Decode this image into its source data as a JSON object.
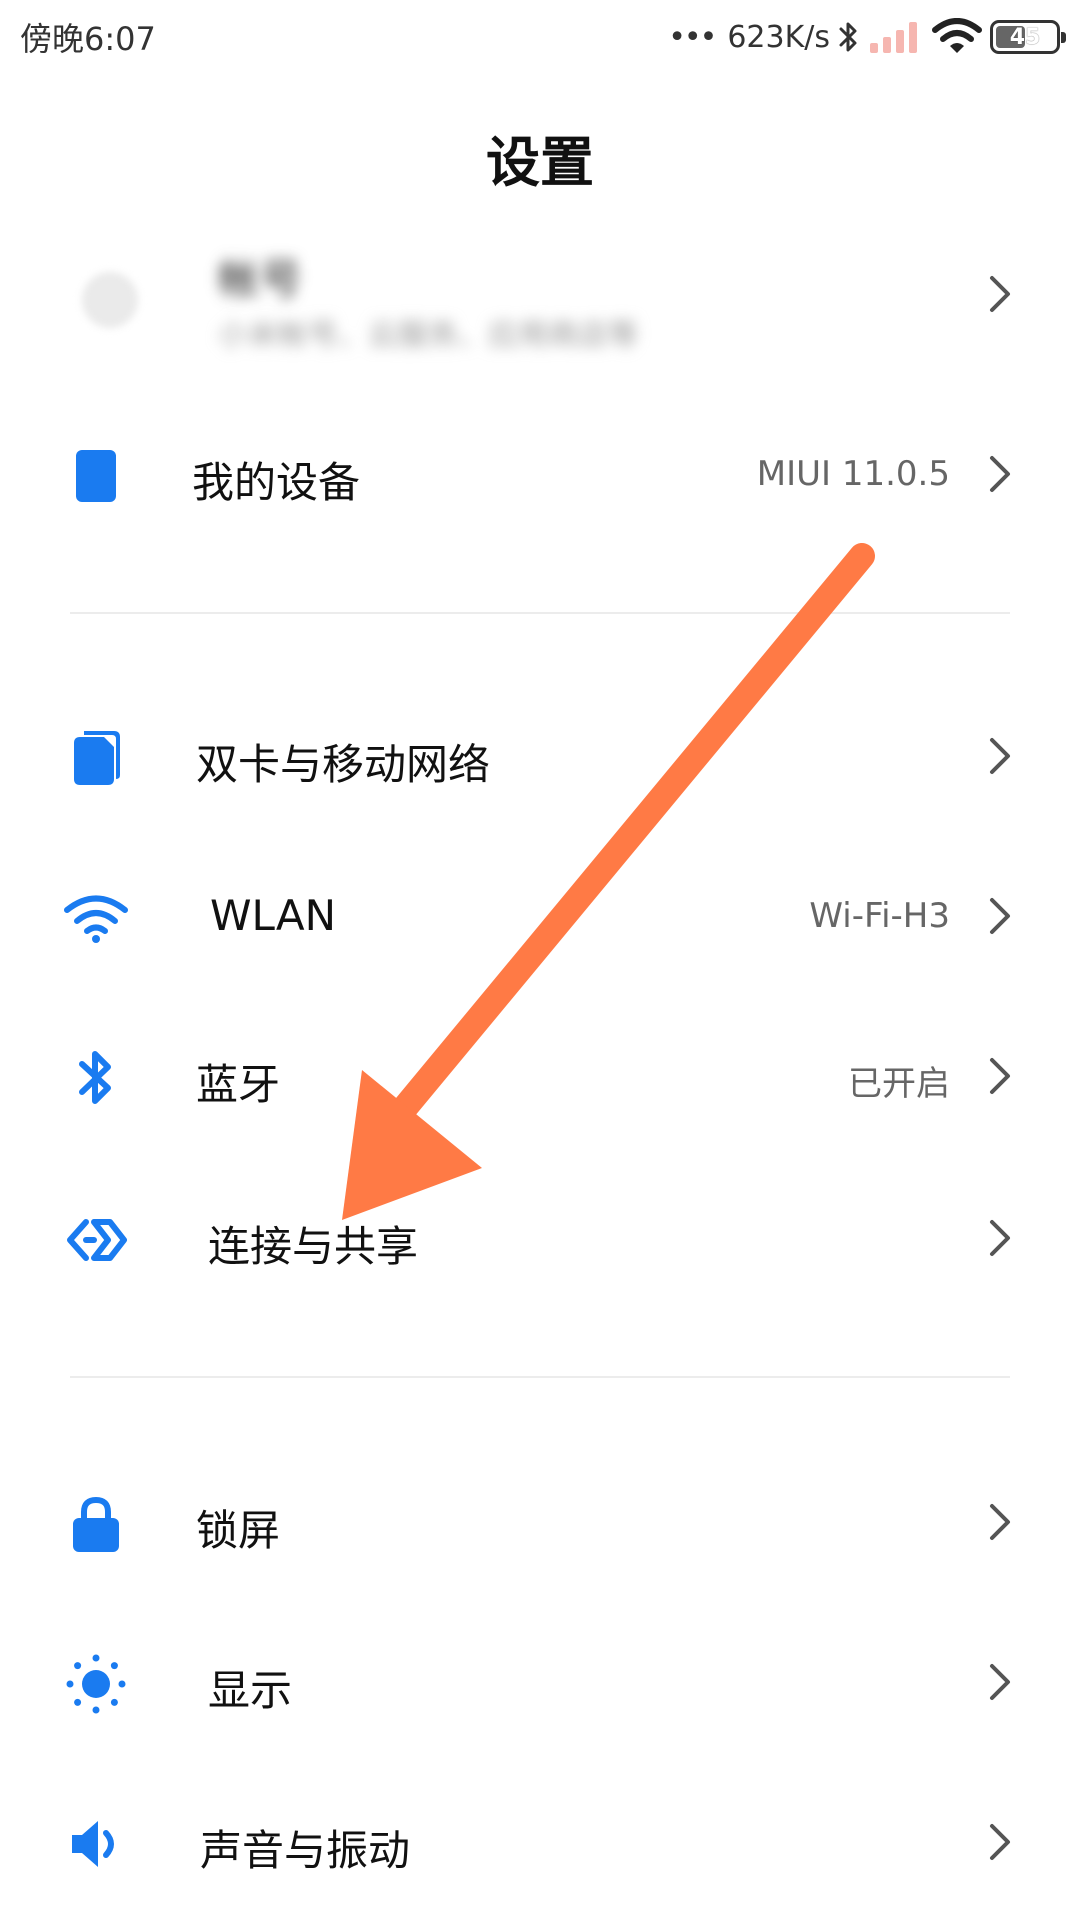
{
  "status_bar": {
    "time": "傍晚6:07",
    "dots": "•••",
    "net_speed": "623K/s",
    "battery": "45"
  },
  "header": {
    "title": "设置"
  },
  "account": {
    "name": "帐号",
    "subtitle": "小米帐号、云服务、应用商店等"
  },
  "colors": {
    "accent": "#1A7BF0",
    "arrow": "#FF7A45",
    "signal_inactive": "#F6B6B0"
  },
  "rows": [
    {
      "label": "我的设备",
      "value": "MIUI 11.0.5",
      "icon": "phone-icon"
    },
    {
      "label": "双卡与移动网络",
      "value": "",
      "icon": "sim-card-icon"
    },
    {
      "label": "WLAN",
      "value": "Wi-Fi-H3",
      "icon": "wifi-icon"
    },
    {
      "label": "蓝牙",
      "value": "已开启",
      "icon": "bluetooth-icon"
    },
    {
      "label": "连接与共享",
      "value": "",
      "icon": "connection-share-icon"
    },
    {
      "label": "锁屏",
      "value": "",
      "icon": "lock-icon"
    },
    {
      "label": "显示",
      "value": "",
      "icon": "sun-icon"
    },
    {
      "label": "声音与振动",
      "value": "",
      "icon": "speaker-icon"
    }
  ]
}
